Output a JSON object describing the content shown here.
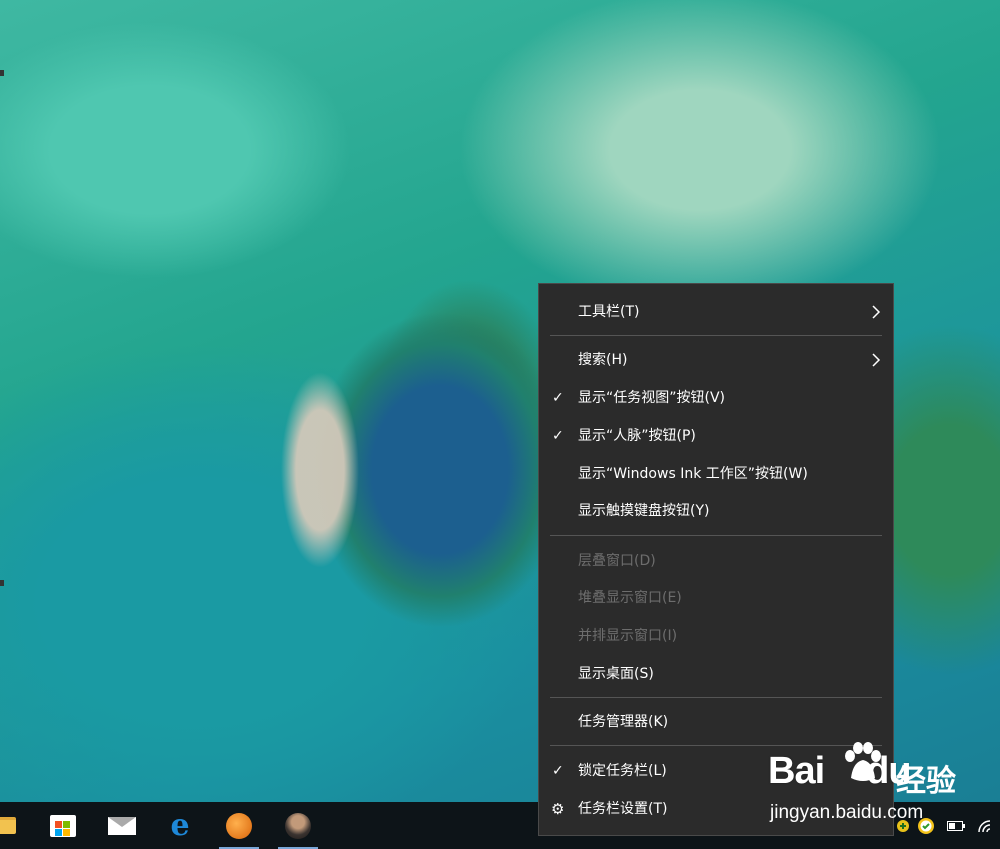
{
  "menu": {
    "items": [
      {
        "label": "工具栏(T)",
        "checked": false,
        "disabled": false,
        "submenu": true
      },
      {
        "label": "搜索(H)",
        "checked": false,
        "disabled": false,
        "submenu": true
      },
      {
        "label": "显示“任务视图”按钮(V)",
        "checked": true,
        "disabled": false
      },
      {
        "label": "显示“人脉”按钮(P)",
        "checked": true,
        "disabled": false
      },
      {
        "label": "显示“Windows Ink 工作区”按钮(W)",
        "checked": false,
        "disabled": false
      },
      {
        "label": "显示触摸键盘按钮(Y)",
        "checked": false,
        "disabled": false
      },
      {
        "label": "层叠窗口(D)",
        "checked": false,
        "disabled": true
      },
      {
        "label": "堆叠显示窗口(E)",
        "checked": false,
        "disabled": true
      },
      {
        "label": "并排显示窗口(I)",
        "checked": false,
        "disabled": true
      },
      {
        "label": "显示桌面(S)",
        "checked": false,
        "disabled": false
      },
      {
        "label": "任务管理器(K)",
        "checked": false,
        "disabled": false
      },
      {
        "label": "锁定任务栏(L)",
        "checked": true,
        "disabled": false
      },
      {
        "label": "任务栏设置(T)",
        "checked": false,
        "disabled": false,
        "icon": "gear-icon"
      }
    ],
    "check_glyph": "✓",
    "gear_glyph": "⚙"
  },
  "taskbar": {
    "apps": [
      {
        "name": "file-explorer-icon"
      },
      {
        "name": "microsoft-store-icon"
      },
      {
        "name": "mail-icon"
      },
      {
        "name": "edge-icon",
        "glyph": "e"
      },
      {
        "name": "orange-app-icon",
        "active": true
      },
      {
        "name": "photo-app-icon",
        "active": true
      }
    ],
    "tray": [
      "tray-shield-icon",
      "tray-check-icon",
      "battery-icon",
      "wifi-icon"
    ]
  },
  "watermark": {
    "brand": "Bai",
    "brand_suffix": "du",
    "jingyan": "经验",
    "url": "jingyan.baidu.com"
  },
  "colors": {
    "menu_bg": "#2b2b2b",
    "menu_text": "#ffffff",
    "menu_disabled": "#6d6d6d",
    "taskbar_bg": "#0d1418",
    "active_indicator": "#7aa7d8"
  }
}
